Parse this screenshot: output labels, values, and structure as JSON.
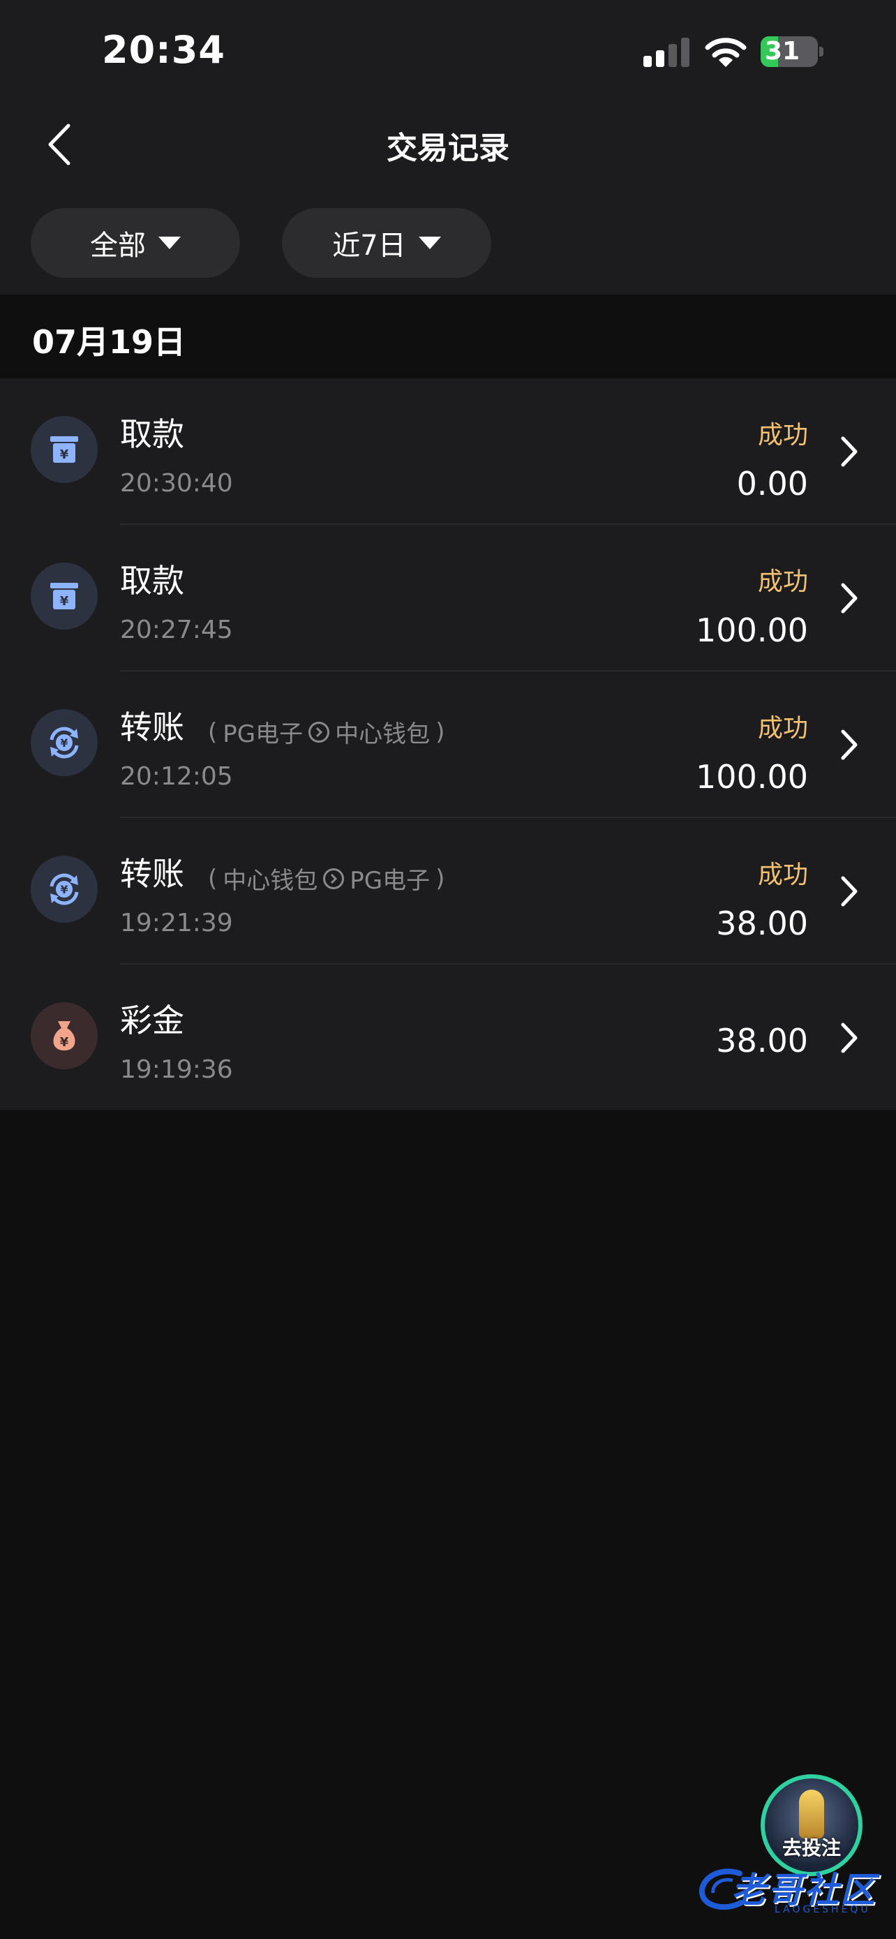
{
  "status_bar": {
    "time": "20:34",
    "battery": "31",
    "battery_level": 0.31
  },
  "header": {
    "title": "交易记录"
  },
  "filters": [
    {
      "label": "全部"
    },
    {
      "label": "近7日"
    }
  ],
  "date_group": "07月19日",
  "transactions": [
    {
      "type": "取款",
      "icon": "withdraw-icon",
      "time": "20:30:40",
      "status": "成功",
      "amount": "0.00"
    },
    {
      "type": "取款",
      "icon": "withdraw-icon",
      "time": "20:27:45",
      "status": "成功",
      "amount": "100.00"
    },
    {
      "type": "转账",
      "icon": "transfer-icon",
      "time": "20:12:05",
      "status": "成功",
      "amount": "100.00",
      "from": "PG电子",
      "to": "中心钱包"
    },
    {
      "type": "转账",
      "icon": "transfer-icon",
      "time": "19:21:39",
      "status": "成功",
      "amount": "38.00",
      "from": "中心钱包",
      "to": "PG电子"
    },
    {
      "type": "彩金",
      "icon": "bonus-icon",
      "time": "19:19:36",
      "amount": "38.00"
    }
  ],
  "promo": {
    "label": "去投注"
  },
  "watermark": {
    "text": "老哥社区",
    "subtext": "LAOGESHEQU"
  },
  "colors": {
    "background": "#0f0f10",
    "card": "#1c1c1e",
    "status_success": "#f3c16f",
    "icon_blue": "#8fb4ff",
    "icon_bonus": "#f0a58a"
  }
}
